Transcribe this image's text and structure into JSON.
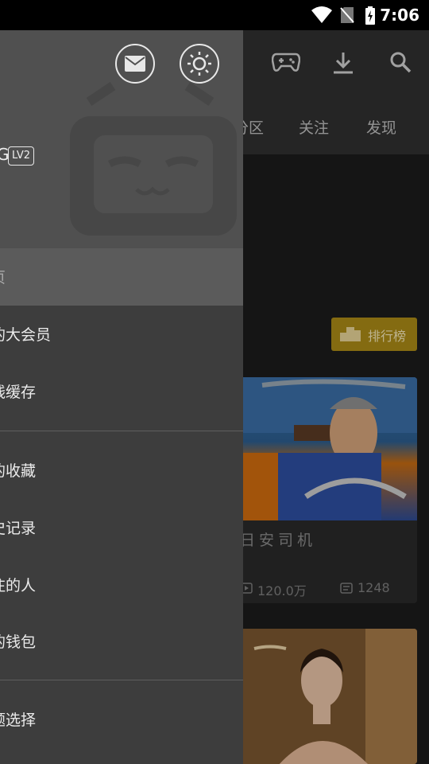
{
  "status_bar": {
    "time": "7:06"
  },
  "toolbar": {
    "icons": [
      "game-controller-icon",
      "download-icon",
      "search-icon"
    ]
  },
  "tabs": [
    {
      "label": "分区"
    },
    {
      "label": "关注"
    },
    {
      "label": "发现"
    }
  ],
  "rank_button": {
    "label": "排行榜"
  },
  "cards": [
    {
      "title": "日安司机",
      "views": "120.0万",
      "danmaku": "1248"
    }
  ],
  "drawer": {
    "header": {
      "username_tail": "G",
      "level": "LV2",
      "icons": [
        "mail-icon",
        "night-mode-icon"
      ]
    },
    "menu_groups": [
      [
        {
          "label": "页",
          "active": true
        },
        {
          "label": "的大会员"
        },
        {
          "label": "线缓存"
        }
      ],
      [
        {
          "label": "的收藏"
        },
        {
          "label": "史记录"
        },
        {
          "label": "注的人"
        },
        {
          "label": "的钱包"
        }
      ],
      [
        {
          "label": "题选择"
        }
      ]
    ]
  },
  "colors": {
    "drawer_bg": "#3d3d3d",
    "header_bg": "#505050",
    "active_item": "#5b5b5b",
    "rank_accent": "#a98a17"
  }
}
